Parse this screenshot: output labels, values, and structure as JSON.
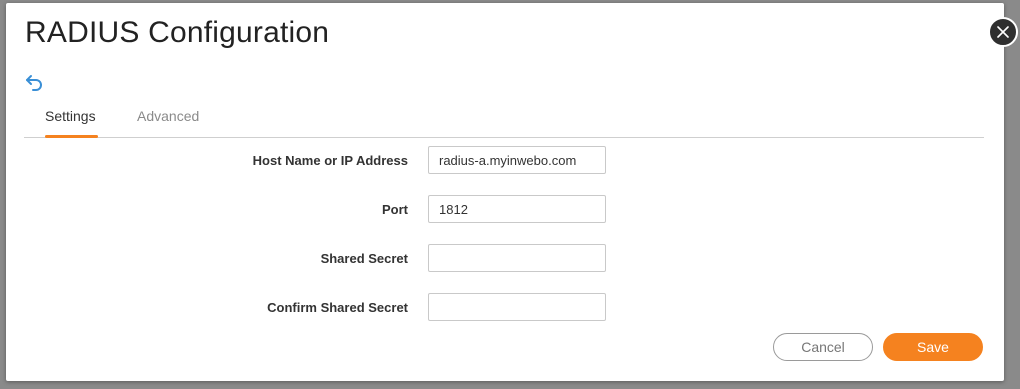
{
  "dialog": {
    "title": "RADIUS Configuration"
  },
  "tabs": [
    {
      "label": "Settings",
      "active": true
    },
    {
      "label": "Advanced",
      "active": false
    }
  ],
  "form": {
    "host": {
      "label": "Host Name or IP Address",
      "value": "radius-a.myinwebo.com"
    },
    "port": {
      "label": "Port",
      "value": "1812"
    },
    "shared_secret": {
      "label": "Shared Secret",
      "value": ""
    },
    "confirm_shared_secret": {
      "label": "Confirm Shared Secret",
      "value": ""
    }
  },
  "buttons": {
    "cancel": "Cancel",
    "save": "Save"
  },
  "icons": {
    "back": "undo-arrow-icon",
    "close": "close-icon"
  },
  "colors": {
    "accent": "#f5821f",
    "back_icon": "#3a8fd6"
  }
}
